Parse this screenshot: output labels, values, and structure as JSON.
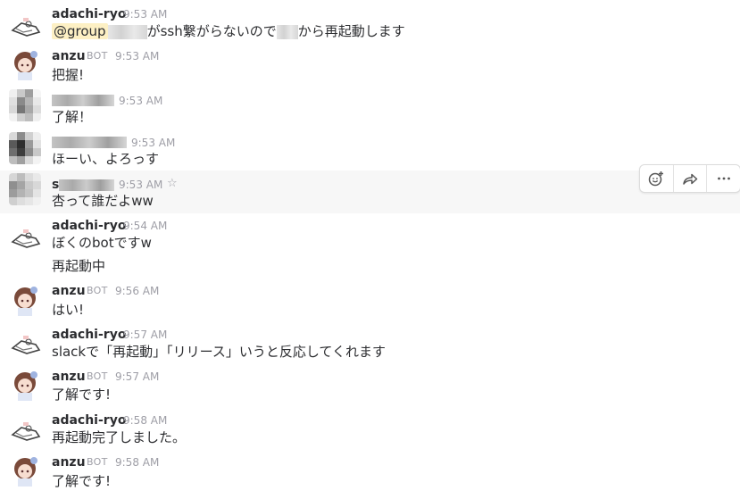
{
  "messages": [
    {
      "author": "adachi-ryo",
      "time": "9:53 AM",
      "lines": [
        {
          "mention": "@group",
          "after": "がssh繋がらないので",
          "after2": "から再起動します"
        }
      ]
    },
    {
      "author": "anzu",
      "bot": "BOT",
      "time": "9:53 AM",
      "lines": [
        "把握!"
      ]
    },
    {
      "time": "9:53 AM",
      "lines": [
        "了解！"
      ]
    },
    {
      "time": "9:53 AM",
      "lines": [
        "ほーい、よろっす"
      ]
    },
    {
      "author_initial": "s",
      "time": "9:53 AM",
      "lines": [
        "杏って誰だよww"
      ]
    },
    {
      "author": "adachi-ryo",
      "time": "9:54 AM",
      "lines": [
        "ぼくのbotですw",
        "再起動中"
      ]
    },
    {
      "author": "anzu",
      "bot": "BOT",
      "time": "9:56 AM",
      "lines": [
        "はい!"
      ]
    },
    {
      "author": "adachi-ryo",
      "time": "9:57 AM",
      "lines": [
        "slackで「再起動」「リリース」いうと反応してくれます"
      ]
    },
    {
      "author": "anzu",
      "bot": "BOT",
      "time": "9:57 AM",
      "lines": [
        "了解です!"
      ]
    },
    {
      "author": "adachi-ryo",
      "time": "9:58 AM",
      "lines": [
        "再起動完了しました。"
      ]
    },
    {
      "author": "anzu",
      "bot": "BOT",
      "time": "9:58 AM",
      "lines": [
        "了解です!"
      ]
    }
  ],
  "icons": {
    "star": "star-icon",
    "reaction": "add-reaction-icon",
    "share": "share-icon",
    "more": "more-actions-icon"
  },
  "colors": {
    "mention_bg": "#fdf0c4",
    "hover_bg": "#f7f7f7",
    "meta": "#9e9ea6"
  }
}
